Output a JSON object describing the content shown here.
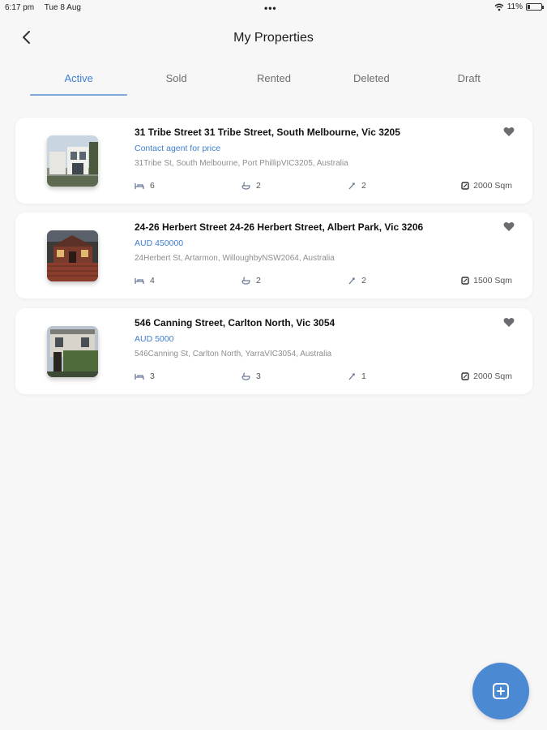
{
  "status_bar": {
    "time": "6:17 pm",
    "date": "Tue 8 Aug",
    "dots": "•••",
    "battery": "11%"
  },
  "header": {
    "title": "My Properties"
  },
  "tabs": [
    {
      "label": "Active",
      "active": true
    },
    {
      "label": "Sold",
      "active": false
    },
    {
      "label": "Rented",
      "active": false
    },
    {
      "label": "Deleted",
      "active": false
    },
    {
      "label": "Draft",
      "active": false
    }
  ],
  "properties": [
    {
      "title": "31 Tribe Street 31 Tribe Street, South Melbourne, Vic 3205",
      "price": "Contact agent for price",
      "address": "31Tribe St, South Melbourne, Port PhillipVIC3205, Australia",
      "beds": "6",
      "baths": "2",
      "parking": "2",
      "area": "2000 Sqm"
    },
    {
      "title": "24-26 Herbert Street 24-26 Herbert Street, Albert Park, Vic 3206",
      "price": "AUD 450000",
      "address": "24Herbert St, Artarmon, WilloughbyNSW2064, Australia",
      "beds": "4",
      "baths": "2",
      "parking": "2",
      "area": "1500 Sqm"
    },
    {
      "title": "546 Canning Street, Carlton North, Vic 3054",
      "price": "AUD 5000",
      "address": "546Canning St, Carlton North, YarraVIC3054, Australia",
      "beds": "3",
      "baths": "3",
      "parking": "1",
      "area": "2000 Sqm"
    }
  ],
  "colors": {
    "accent": "#3f7fd0",
    "fab": "#4b8ad3",
    "background": "#f7f7f8"
  }
}
